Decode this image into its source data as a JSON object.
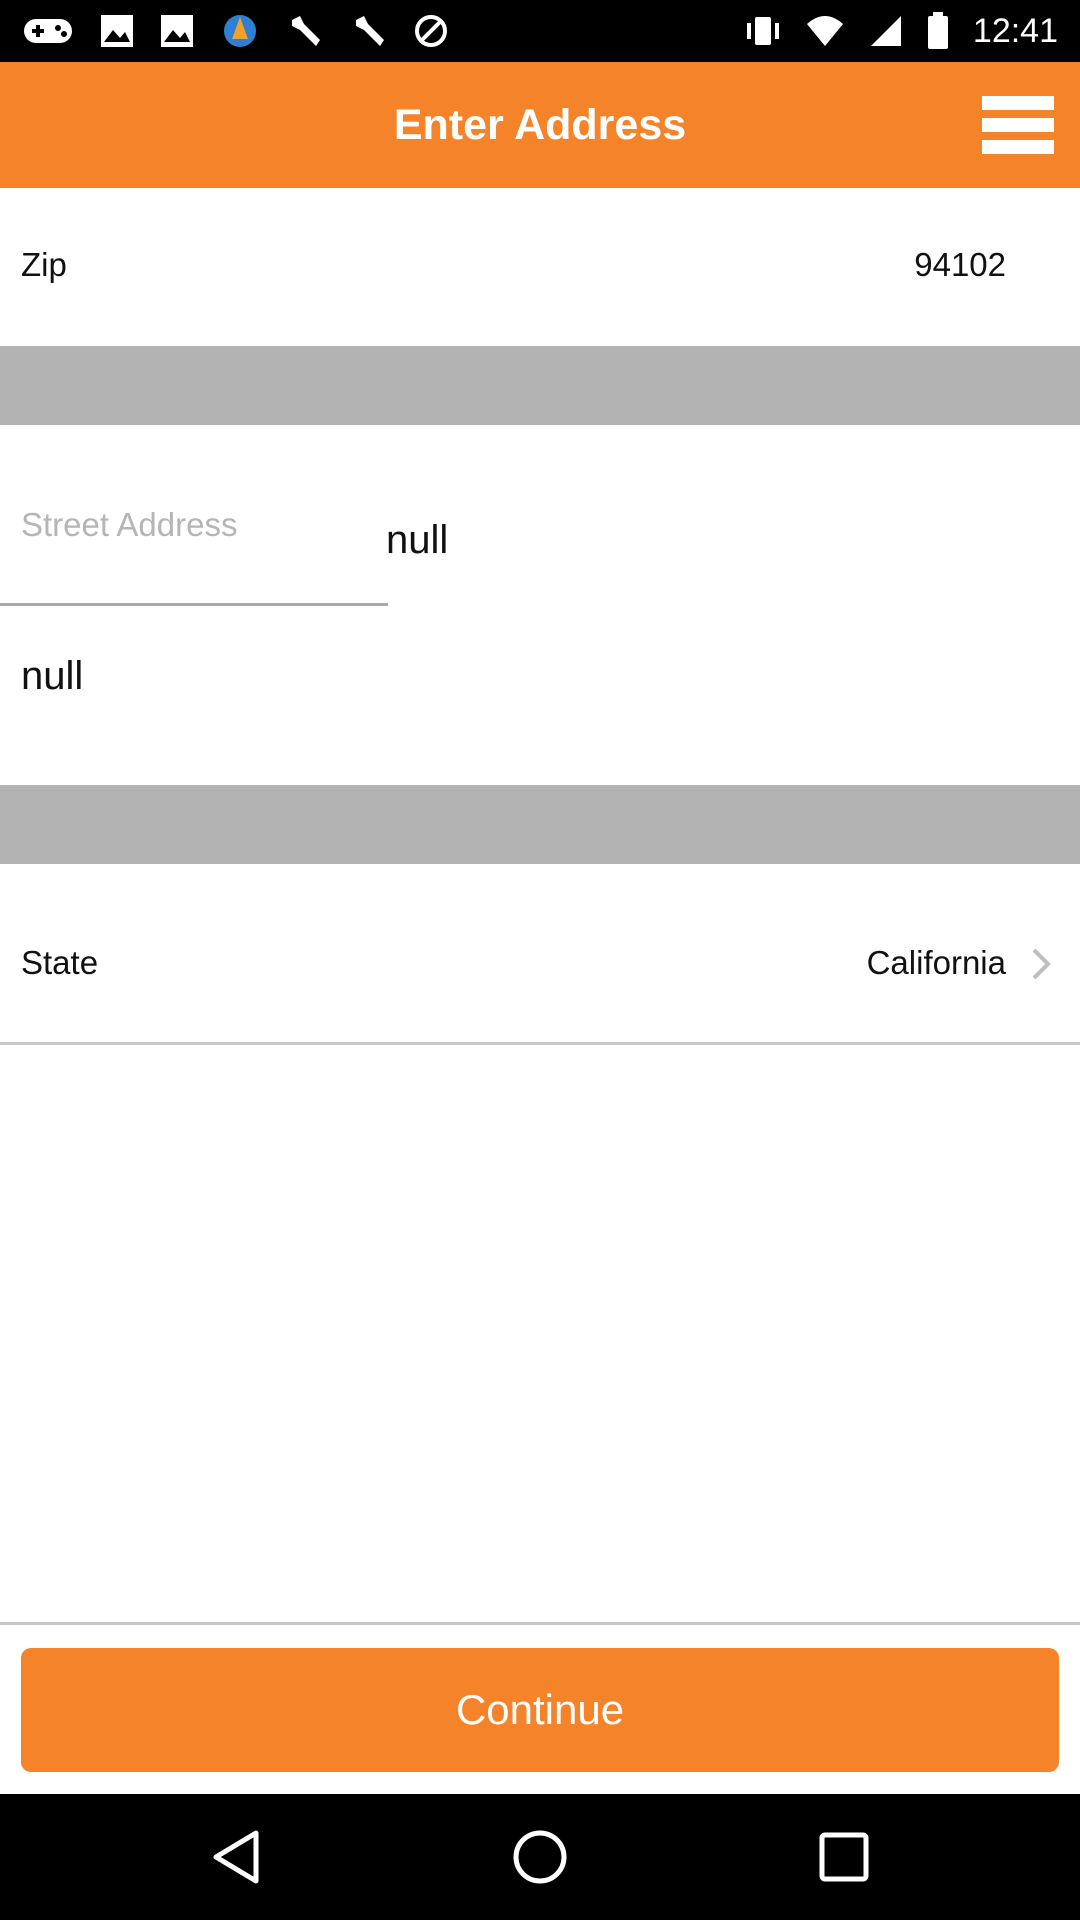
{
  "status_bar": {
    "time": "12:41"
  },
  "header": {
    "title": "Enter Address"
  },
  "zip": {
    "label": "Zip",
    "value": "94102"
  },
  "address": {
    "street_placeholder": "Street Address",
    "street_value": "null",
    "second_line_value": "null"
  },
  "state": {
    "label": "State",
    "value": "California"
  },
  "footer": {
    "continue_label": "Continue"
  },
  "colors": {
    "accent": "#f5832a",
    "separator": "#b3b3b3"
  }
}
